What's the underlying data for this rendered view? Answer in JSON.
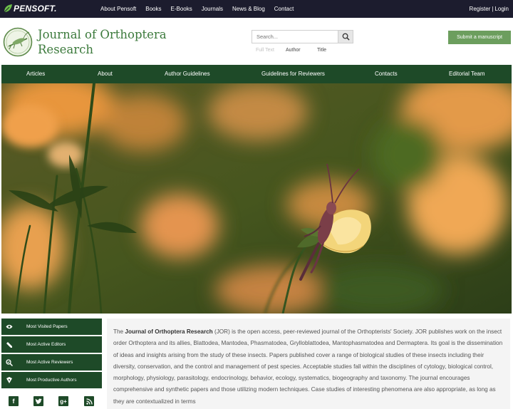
{
  "topbar": {
    "brand": "PENSOFT.",
    "nav": [
      "About Pensoft",
      "Books",
      "E-Books",
      "Journals",
      "News & Blog",
      "Contact"
    ],
    "register": "Register",
    "separator": "|",
    "login": "Login"
  },
  "header": {
    "title_line1": "Journal of Orthoptera",
    "title_line2": "Research",
    "search_placeholder": "Search...",
    "scopes": [
      "Full Text",
      "Author",
      "Title"
    ],
    "submit_label": "Submit a manuscript"
  },
  "mainnav": [
    "Articles",
    "About",
    "Author Guidelines",
    "Guidelines for Reviewers",
    "Contacts",
    "Editorial Team"
  ],
  "sidebar": {
    "items": [
      {
        "label": "Most Visited Papers",
        "icon": "eye-icon"
      },
      {
        "label": "Most Active Editors",
        "icon": "pencil-icon"
      },
      {
        "label": "Most Active Reviewers",
        "icon": "magnifier-check-icon"
      },
      {
        "label": "Most Productive Authors",
        "icon": "pen-nib-icon"
      }
    ],
    "social": [
      {
        "icon": "facebook-icon",
        "glyph": "f"
      },
      {
        "icon": "twitter-icon",
        "glyph": "t"
      },
      {
        "icon": "google-plus-icon",
        "glyph": "g+"
      },
      {
        "icon": "rss-icon",
        "glyph": "rss"
      }
    ]
  },
  "about": {
    "intro": "The ",
    "journal_name": "Journal of Orthoptera Research",
    "text": " (JOR) is the open access, peer-reviewed journal of the Orthopterists' Society. JOR publishes work on the insect order Orthoptera and its allies, Blattodea, Mantodea, Phasmatodea, Grylloblattodea, Mantophasmatodea and Dermaptera. Its goal is the dissemination of ideas and insights arising from the study of these insects. Papers published cover a range of biological studies of these insects including their diversity, conservation, and the control and management of pest species. Acceptable studies fall within the disciplines of cytology, biological control, morphology, physiology, parasitology, endocrinology, behavior, ecology, systematics, biogeography and taxonomy. The journal encourages comprehensive and synthetic papers and those utilizing modern techniques. Case studies of interesting phenomena are also appropriate, as long as they are contextualized in terms"
  },
  "colors": {
    "topbar": "#1c1c2e",
    "nav_green": "#1e4a28",
    "title_green": "#3c7a3c",
    "submit_green": "#6c9e5e"
  }
}
